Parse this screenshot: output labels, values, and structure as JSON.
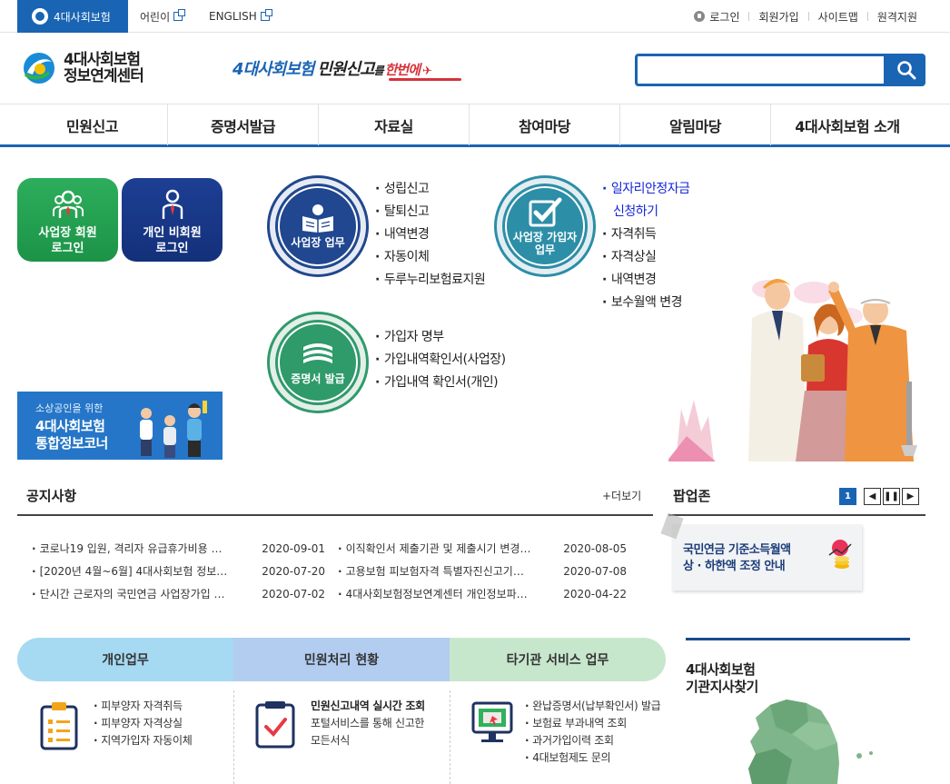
{
  "utility": {
    "active_tab": "4대사회보험",
    "kids": "어린이",
    "english": "ENGLISH",
    "login": "로그인",
    "join": "회원가입",
    "sitemap": "사이트맵",
    "remote": "원격지원"
  },
  "header": {
    "brand_line1": "4대사회보험",
    "brand_line2": "정보연계센터",
    "slogan_part1": "4대사회보험",
    "slogan_part2": "민원신고",
    "slogan_part3": "를",
    "slogan_part4": "한번에",
    "search_placeholder": ""
  },
  "gnb": [
    "민원신고",
    "증명서발급",
    "자료실",
    "참여마당",
    "알림마당",
    "4대사회보험 소개"
  ],
  "login": {
    "biz_line1": "사업장 회원",
    "biz_line2": "로그인",
    "ind_line1": "개인 비회원",
    "ind_line2": "로그인"
  },
  "banner": {
    "line1": "소상공인을 위한",
    "line2": "4대사회보험",
    "line3": "통합정보코너"
  },
  "work": {
    "biz": {
      "label": "사업장 업무",
      "items": [
        "성립신고",
        "탈퇴신고",
        "내역변경",
        "자동이체",
        "두루누리보험료지원"
      ]
    },
    "member": {
      "label_line1": "사업장 가입자",
      "label_line2": "업무",
      "highlight_line1": "일자리안정자금",
      "highlight_line2": "신청하기",
      "items": [
        "자격취득",
        "자격상실",
        "내역변경",
        "보수월액 변경"
      ]
    },
    "cert": {
      "label": "증명서 발급",
      "items": [
        "가입자 명부",
        "가입내역확인서(사업장)",
        "가입내역 확인서(개인)"
      ]
    }
  },
  "notice": {
    "title": "공지사항",
    "more": "+더보기",
    "col1": [
      {
        "title": "코로나19 입원, 격리자 유급휴가비용 …",
        "date": "2020-09-01"
      },
      {
        "title": "[2020년 4월~6월] 4대사회보험 정보…",
        "date": "2020-07-20"
      },
      {
        "title": "단시간 근로자의 국민연금 사업장가입 …",
        "date": "2020-07-02"
      }
    ],
    "col2": [
      {
        "title": "이직확인서 제출기관 및 제출시기 변경…",
        "date": "2020-08-05"
      },
      {
        "title": "고용보험 피보험자격 특별자진신고기…",
        "date": "2020-07-08"
      },
      {
        "title": "4대사회보험정보연계센터 개인정보파…",
        "date": "2020-04-22"
      }
    ]
  },
  "popup": {
    "title": "팝업존",
    "page": "1",
    "card_line1": "국민연금 기준소득월액",
    "card_line2": "상 · 하한액 조정 안내"
  },
  "tabs": {
    "personal": {
      "label": "개인업무",
      "items": [
        "피부양자 자격취득",
        "피부양자 자격상실",
        "지역가입자 자동이체"
      ]
    },
    "status": {
      "label": "민원처리 현황",
      "heading": "민원신고내역 실시간 조회",
      "desc1": "포털서비스를 통해 신고한",
      "desc2": "모든서식"
    },
    "other": {
      "label": "타기관 서비스 업무",
      "items": [
        "완납증명서(납부확인서) 발급",
        "보험료 부과내역 조회",
        "과거가입이력 조회",
        "4대보험제도 문의"
      ]
    }
  },
  "branch": {
    "line1": "4대사회보험",
    "line2": "기관지사찾기"
  },
  "colors": {
    "primary": "#1a64b4",
    "accent_red": "#d6323a",
    "biz_green": "#1c9347",
    "ind_navy": "#13307a"
  }
}
